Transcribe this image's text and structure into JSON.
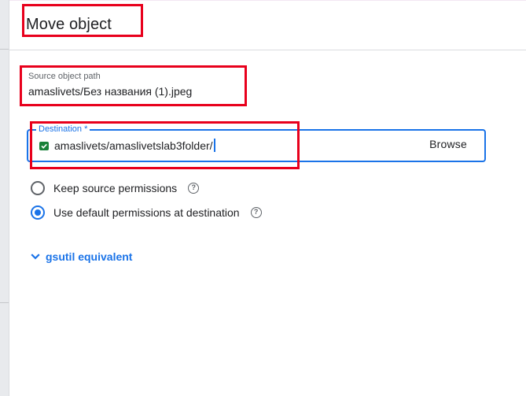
{
  "dialog": {
    "title": "Move object"
  },
  "source": {
    "label": "Source object path",
    "value": "amaslivets/Без названия (1).jpeg"
  },
  "destination": {
    "label": "Destination *",
    "value": "amaslivets/amaslivetslab3folder/",
    "browse_label": "Browse",
    "icon": "bucket-check-icon"
  },
  "permissions": {
    "options": [
      {
        "label": "Keep source permissions",
        "selected": false
      },
      {
        "label": "Use default permissions at destination",
        "selected": true
      }
    ]
  },
  "gsutil": {
    "label": "gsutil equivalent"
  },
  "colors": {
    "accent": "#1a73e8",
    "highlight": "#e8001c",
    "bucket": "#188038"
  }
}
